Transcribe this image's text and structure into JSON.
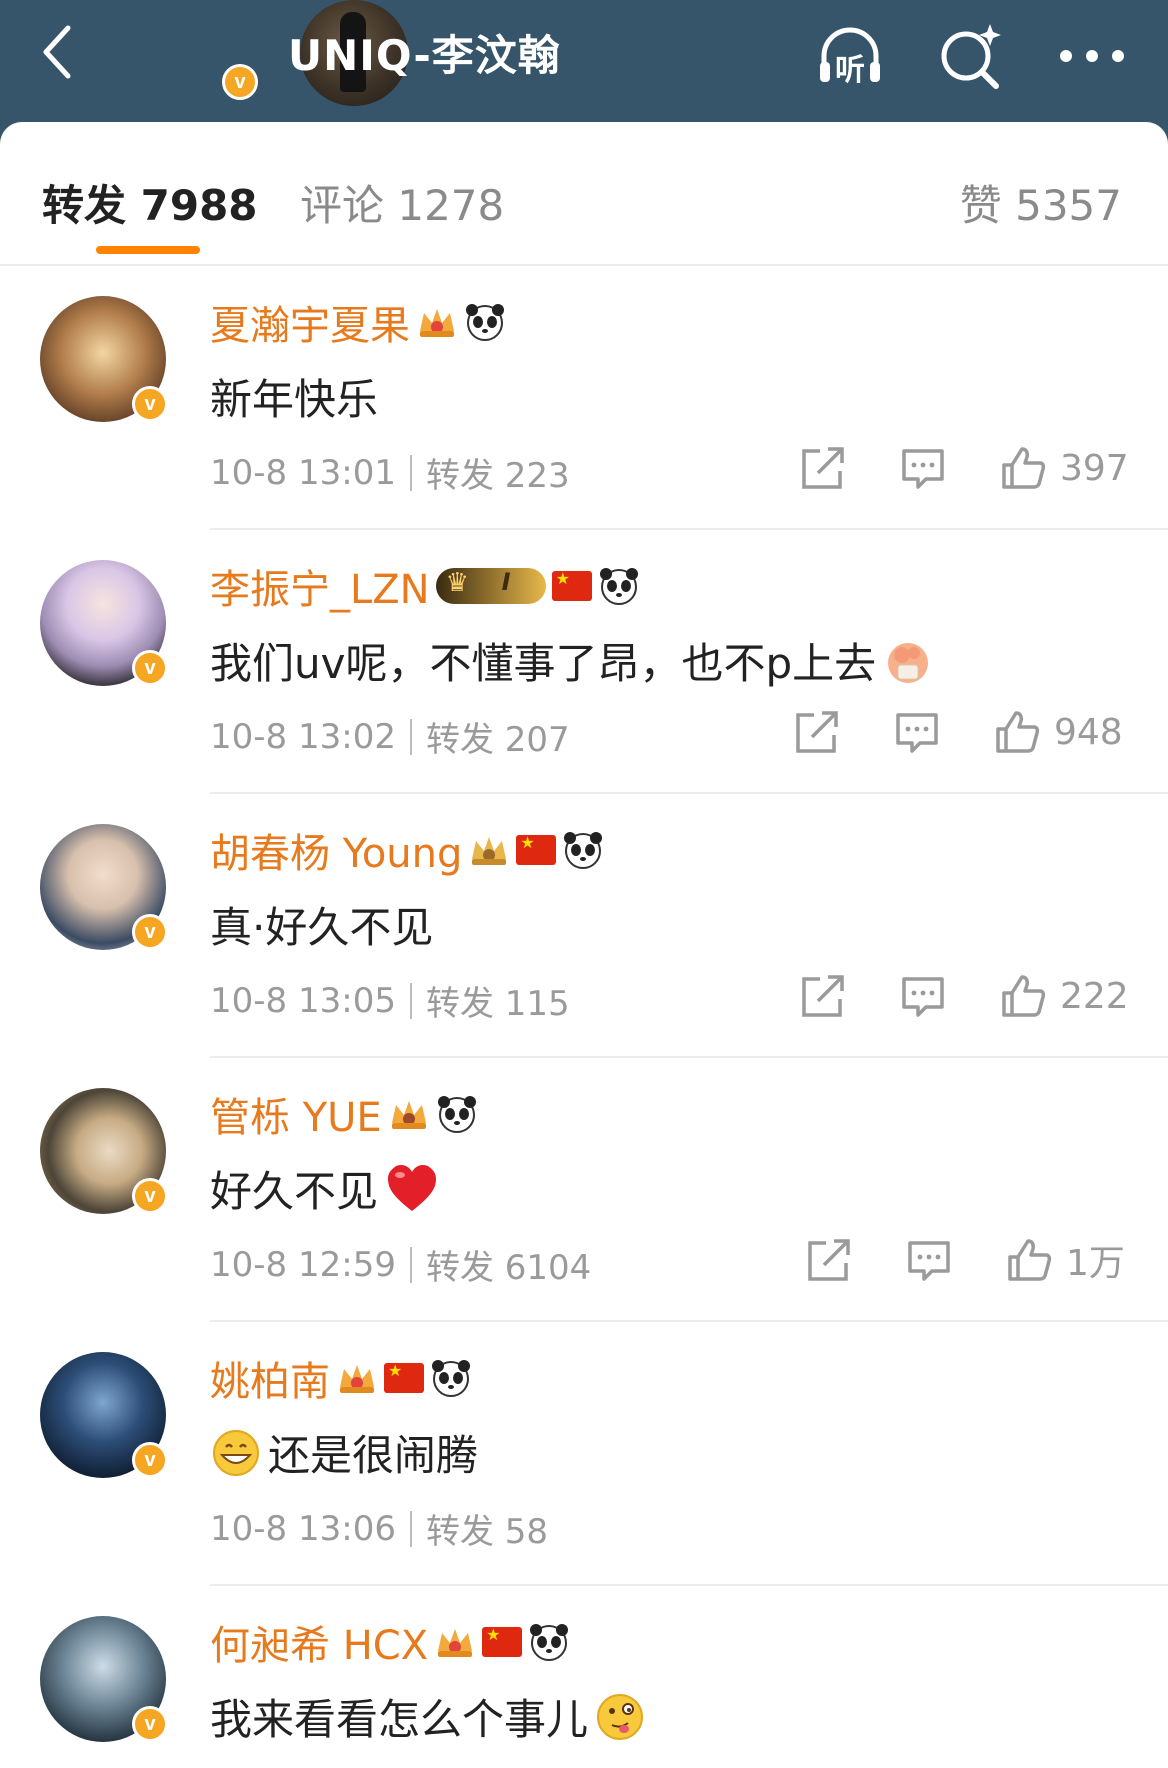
{
  "header": {
    "title": "UNIQ-李汶翰",
    "back_icon": "back-arrow-icon",
    "listen_label": "听",
    "search_icon": "search-sparkle-icon",
    "more_icon": "more-icon"
  },
  "tabs": {
    "repost": "转发 7988",
    "comment": "评论 1278",
    "like": "赞 5357"
  },
  "colors": {
    "header_bg": "#36556a",
    "accent": "#ff8200",
    "name": "#e67a1d",
    "meta": "#9a9a9a"
  },
  "comments": [
    {
      "name": "夏瀚宇夏果",
      "text": "新年快乐",
      "date": "10-8 13:01",
      "repost": "转发 223",
      "likes": "397",
      "badges": [
        "crown-icon",
        "panda-icon"
      ]
    },
    {
      "name": "李振宁_LZN",
      "text": "我们uv呢，不懂事了昂，也不p上去",
      "date": "10-8 13:02",
      "repost": "转发 207",
      "likes": "948",
      "badges": [
        "vip-badge",
        "flag-icon",
        "panda-icon"
      ],
      "vip_level": "I"
    },
    {
      "name": "胡春杨 Young",
      "text": "真·好久不见",
      "date": "10-8 13:05",
      "repost": "转发 115",
      "likes": "222",
      "badges": [
        "crown-icon",
        "flag-icon",
        "panda-icon"
      ]
    },
    {
      "name": "管栎 YUE",
      "text": "好久不见",
      "date": "10-8 12:59",
      "repost": "转发 6104",
      "likes": "1万",
      "badges": [
        "crown-icon",
        "panda-icon"
      ]
    },
    {
      "name": "姚柏南",
      "text": "还是很闹腾",
      "date": "10-8 13:06",
      "repost": "转发 58",
      "likes": "",
      "badges": [
        "crown-icon",
        "flag-icon",
        "panda-icon"
      ]
    },
    {
      "name": "何昶希 HCX",
      "text": "我来看看怎么个事儿",
      "date": "",
      "repost": "",
      "likes": "",
      "badges": [
        "crown-icon",
        "flag-icon",
        "panda-icon"
      ]
    }
  ]
}
